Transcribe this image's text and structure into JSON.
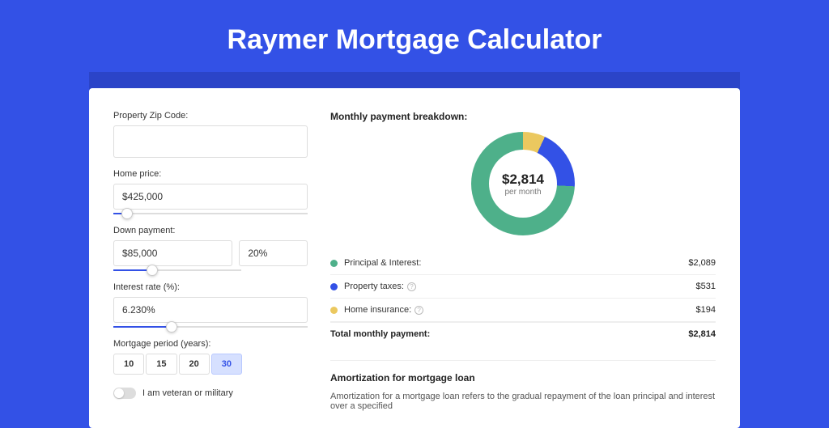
{
  "page_title": "Raymer Mortgage Calculator",
  "form": {
    "zip_label": "Property Zip Code:",
    "zip_value": "",
    "home_price_label": "Home price:",
    "home_price_value": "$425,000",
    "home_price_slider_pct": 7,
    "down_payment_label": "Down payment:",
    "down_payment_value": "$85,000",
    "down_payment_pct_value": "20%",
    "down_payment_slider_pct": 20,
    "interest_label": "Interest rate (%):",
    "interest_value": "6.230%",
    "interest_slider_pct": 30,
    "period_label": "Mortgage period (years):",
    "period_options": [
      "10",
      "15",
      "20",
      "30"
    ],
    "period_active": "30",
    "veteran_label": "I am veteran or military"
  },
  "breakdown": {
    "heading": "Monthly payment breakdown:",
    "center_amount": "$2,814",
    "center_sub": "per month",
    "items": [
      {
        "color": "green",
        "label": "Principal & Interest:",
        "value": "$2,089"
      },
      {
        "color": "blue",
        "label": "Property taxes:",
        "value": "$531",
        "info": true
      },
      {
        "color": "yellow",
        "label": "Home insurance:",
        "value": "$194",
        "info": true
      }
    ],
    "total_label": "Total monthly payment:",
    "total_value": "$2,814"
  },
  "amortization": {
    "heading": "Amortization for mortgage loan",
    "text": "Amortization for a mortgage loan refers to the gradual repayment of the loan principal and interest over a specified"
  },
  "chart_data": {
    "type": "pie",
    "title": "Monthly payment breakdown",
    "series": [
      {
        "name": "Principal & Interest",
        "value": 2089,
        "color": "#4eb08a"
      },
      {
        "name": "Property taxes",
        "value": 531,
        "color": "#3351e6"
      },
      {
        "name": "Home insurance",
        "value": 194,
        "color": "#ebc85f"
      }
    ],
    "total": 2814,
    "center_label": "$2,814 per month"
  }
}
